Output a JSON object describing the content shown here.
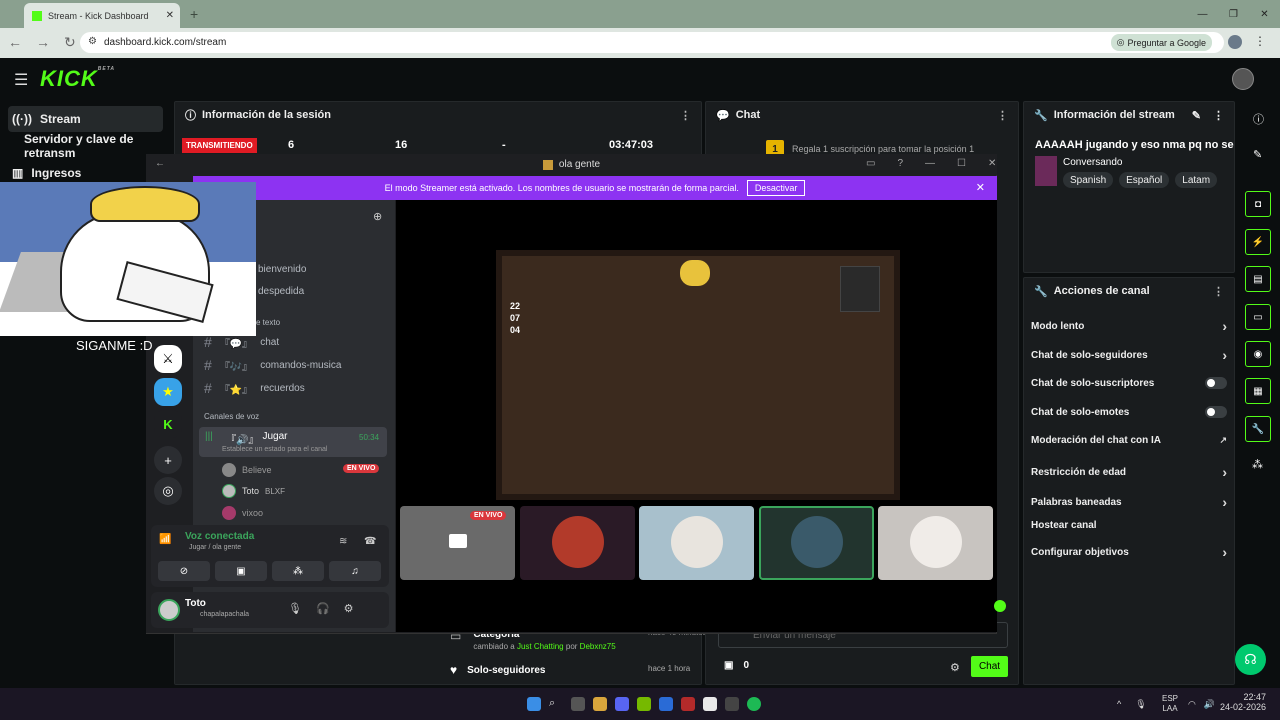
{
  "browser": {
    "tab_title": "Stream - Kick Dashboard",
    "url": "dashboard.kick.com/stream",
    "google_button": "Preguntar a Google"
  },
  "sidebar": {
    "items": [
      {
        "label": "Stream",
        "icon": "broadcast-icon"
      },
      {
        "label": "Servidor y clave de retransm"
      },
      {
        "label": "Ingresos",
        "icon": "chart-icon"
      }
    ]
  },
  "session": {
    "title": "Información de la sesión",
    "status": "TRANSMITIENDO",
    "viewers": "6",
    "followers": "16",
    "dash": "-",
    "duration": "03:47:03"
  },
  "chat": {
    "title": "Chat",
    "gift_text": "Regala 1 suscripción para tomar la posición 1",
    "gift_position": "1",
    "placeholder": "Enviar un mensaje",
    "count": "0",
    "send": "Chat"
  },
  "activity": [
    {
      "title": "Categoría",
      "detail_pre": "cambiado a",
      "category": "Just Chatting",
      "by": "por",
      "user": "Debxnz75",
      "time": "hace 40 minutos"
    },
    {
      "title": "Solo-seguidores",
      "time": "hace 1 hora"
    }
  ],
  "stream_info": {
    "title": "Información del stream",
    "stream_title": "AAAAAH jugando y eso nma pq no se",
    "category": "Conversando",
    "tags": [
      "Spanish",
      "Español",
      "Latam",
      "Sh"
    ]
  },
  "channel_actions": {
    "title": "Acciones de canal",
    "items": [
      {
        "label": "Modo lento",
        "control": "chevron"
      },
      {
        "label": "Chat de solo-seguidores",
        "control": "chevron"
      },
      {
        "label": "Chat de solo-suscriptores",
        "control": "toggle"
      },
      {
        "label": "Chat de solo-emotes",
        "control": "toggle"
      },
      {
        "label": "Moderación del chat con IA",
        "control": "external"
      },
      {
        "label": "Restricción de edad",
        "control": "chevron"
      },
      {
        "label": "Palabras baneadas",
        "control": "chevron"
      },
      {
        "label": "Hostear canal",
        "control": "none"
      },
      {
        "label": "Configurar objetivos",
        "control": "chevron"
      }
    ]
  },
  "discord": {
    "window_title": "ola gente",
    "streamer_banner": "El modo Streamer está activado. Los nombres de usuario se mostrarán de forma parcial.",
    "deactivate": "Desactivar",
    "channels": [
      {
        "name": "bienvenido"
      },
      {
        "name": "despedida"
      },
      {
        "name": "chat"
      },
      {
        "name": "comandos-musica"
      },
      {
        "name": "recuerdos"
      }
    ],
    "section_text": "e texto",
    "section_voice": "Canales de voz",
    "voice_channel": "Jugar",
    "voice_time": "50:34",
    "voice_status_hint": "Establece un estado para el canal",
    "voice_users": [
      {
        "name": "Believe",
        "live": "EN VIVO"
      },
      {
        "name": "Toto",
        "tag": "BLXF"
      },
      {
        "name": "vixoo"
      }
    ],
    "voice_connected": "Voz conectada",
    "voice_connected_sub": "Jugar / ola gente",
    "user_name": "Toto",
    "user_sub": "chapalapachala",
    "live_badge": "EN VIVO"
  },
  "overlay_text": "SIGANME :D",
  "game_hud": [
    "22",
    "07",
    "04"
  ],
  "clock": {
    "time": "22:47",
    "date": "24-02-2026",
    "lang": "ESP",
    "region": "LAA"
  }
}
